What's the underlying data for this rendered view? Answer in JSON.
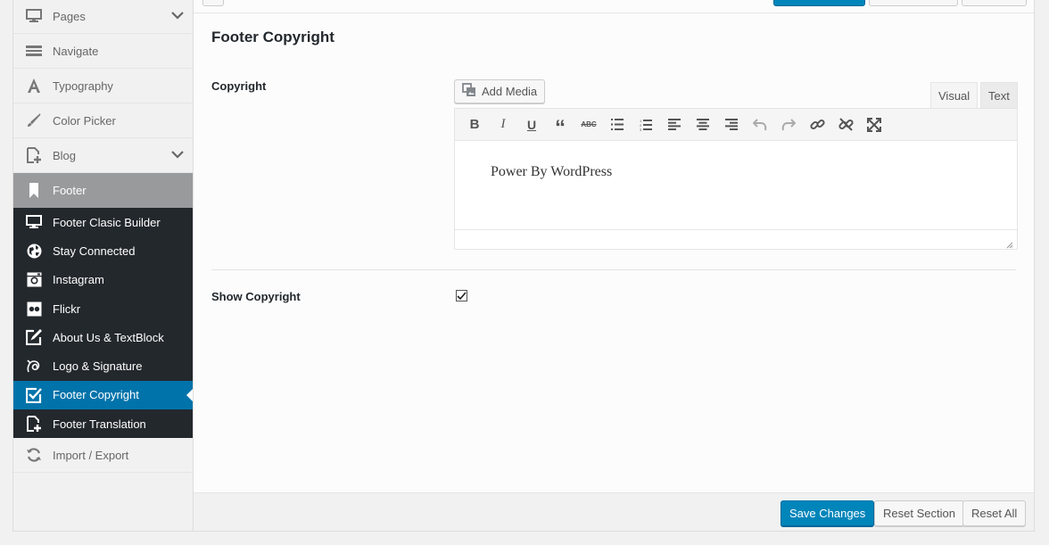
{
  "sidebar": {
    "items": [
      {
        "label": "Pages",
        "icon": "monitor-icon",
        "chevron": true
      },
      {
        "label": "Navigate",
        "icon": "navigate-icon",
        "chevron": false
      },
      {
        "label": "Typography",
        "icon": "typography-icon",
        "chevron": false
      },
      {
        "label": "Color Picker",
        "icon": "brush-icon",
        "chevron": false
      },
      {
        "label": "Blog",
        "icon": "doc-plus-icon",
        "chevron": true
      },
      {
        "label": "Footer",
        "icon": "bookmark-icon",
        "chevron": false
      }
    ],
    "submenu": [
      {
        "label": "Footer Clasic Builder",
        "icon": "monitor-icon"
      },
      {
        "label": "Stay Connected",
        "icon": "globe-icon"
      },
      {
        "label": "Instagram",
        "icon": "instagram-icon"
      },
      {
        "label": "Flickr",
        "icon": "flickr-icon"
      },
      {
        "label": "About Us & TextBlock",
        "icon": "edit-icon"
      },
      {
        "label": "Logo & Signature",
        "icon": "signature-icon"
      },
      {
        "label": "Footer Copyright",
        "icon": "checkbox-icon"
      },
      {
        "label": "Footer Translation",
        "icon": "doc-plus-icon"
      }
    ],
    "bottom_items": [
      {
        "label": "Import / Export",
        "icon": "refresh-icon"
      }
    ]
  },
  "main": {
    "section_title": "Footer Copyright",
    "copyright_label": "Copyright",
    "add_media_label": "Add Media",
    "tab_visual": "Visual",
    "tab_text": "Text",
    "editor_content": "Power By WordPress",
    "show_copyright_label": "Show Copyright",
    "show_copyright_checked": true
  },
  "footer": {
    "save_label": "Save Changes",
    "reset_section_label": "Reset Section",
    "reset_all_label": "Reset All"
  },
  "colors": {
    "accent": "#0073aa",
    "primary_button": "#0085ba",
    "submenu_bg": "#23282d",
    "active_item_bg": "#999a9c"
  }
}
